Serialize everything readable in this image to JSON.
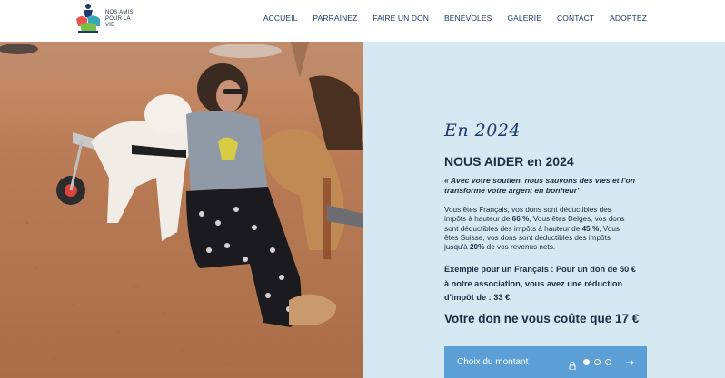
{
  "header": {
    "logo_text": "NOS AMIS POUR LA VIE",
    "nav": [
      "ACCUEIL",
      "PARRAINEZ",
      "FAIRE UN DON",
      "BÉNÉVOLES",
      "GALERIE",
      "CONTACT",
      "ADOPTEZ"
    ]
  },
  "panel": {
    "year_title": "En 2024",
    "title": "NOUS AIDER en 2024",
    "quote": "« Avec votre soutien, nous sauvons des vies et l'on transforme votre argent en bonheur'",
    "body": {
      "p1_a": "Vous êtes Français, vos dons sont déductibles des impôts à hauteur de ",
      "p1_b": "66 %",
      "p1_c": ", Vous êtes Belges, vos dons sont déductibles des impôts à hauteur de ",
      "p1_d": "45 %",
      "p1_e": ", Vous êtes Suisse, vos dons sont déductibles des impôts jusqu'à ",
      "p1_f": "20%",
      "p1_g": " de vos revenus nets."
    },
    "example": "Exemple pour un Français : Pour un don de 50 € à notre association, vous avez une réduction d'impôt de : 33 €.",
    "cost": "Votre don ne vous coûte que 17 €",
    "donate": {
      "label": "Choix du montant",
      "steps_total": 3,
      "active_step": 1,
      "icons": [
        "lock-icon",
        "arrow-right-icon"
      ]
    }
  },
  "colors": {
    "panel_bg": "#d6e9f3",
    "accent_blue": "#5b9fd6",
    "text_dark": "#1f2a44",
    "nav_blue": "#1e3a6e"
  }
}
